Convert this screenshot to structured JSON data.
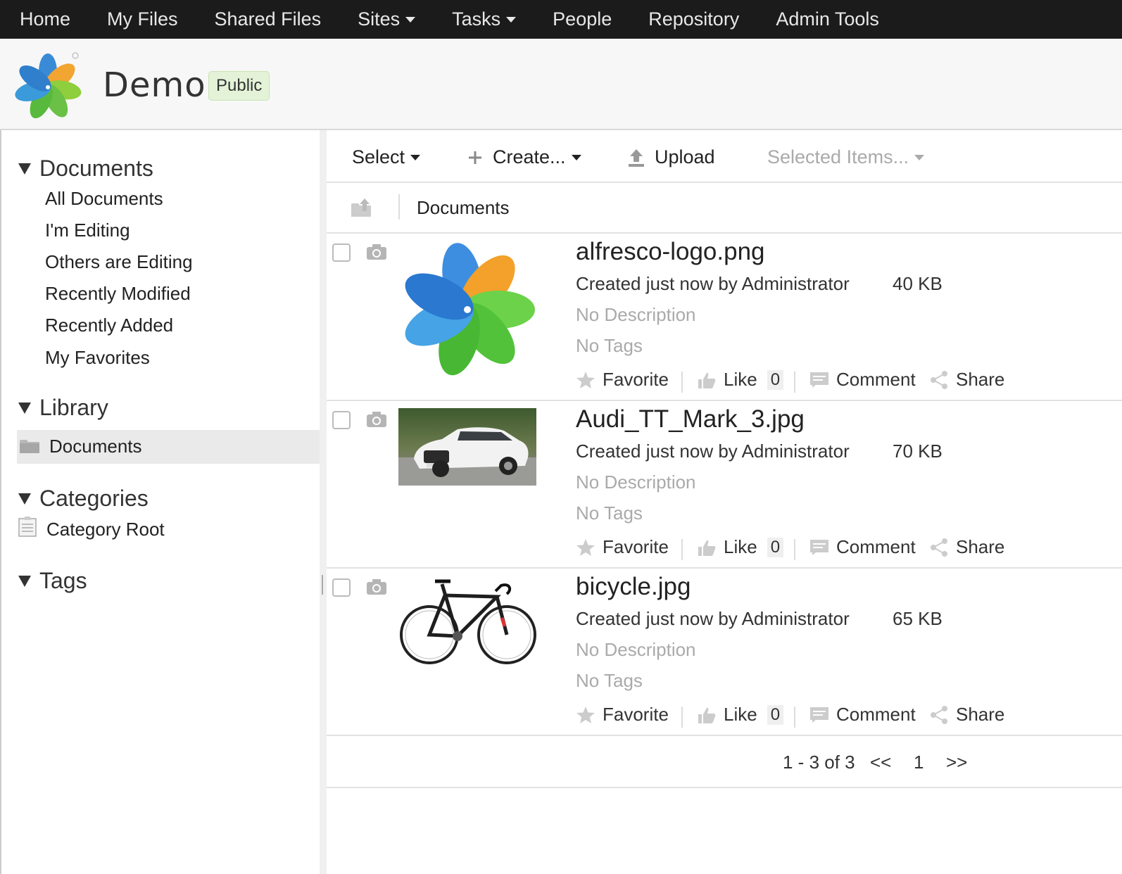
{
  "topnav": {
    "items": [
      {
        "label": "Home",
        "dropdown": false
      },
      {
        "label": "My Files",
        "dropdown": false
      },
      {
        "label": "Shared Files",
        "dropdown": false
      },
      {
        "label": "Sites",
        "dropdown": true
      },
      {
        "label": "Tasks",
        "dropdown": true
      },
      {
        "label": "People",
        "dropdown": false
      },
      {
        "label": "Repository",
        "dropdown": false
      },
      {
        "label": "Admin Tools",
        "dropdown": false
      }
    ]
  },
  "site": {
    "title": "Demo",
    "visibility": "Public"
  },
  "sidebar": {
    "documents": {
      "heading": "Documents",
      "items": [
        "All Documents",
        "I'm Editing",
        "Others are Editing",
        "Recently Modified",
        "Recently Added",
        "My Favorites"
      ]
    },
    "library": {
      "heading": "Library",
      "folder": "Documents"
    },
    "categories": {
      "heading": "Categories",
      "root": "Category Root"
    },
    "tags": {
      "heading": "Tags"
    }
  },
  "toolbar": {
    "select_label": "Select",
    "create_label": "Create...",
    "upload_label": "Upload",
    "selected_items_label": "Selected Items..."
  },
  "breadcrumb": {
    "current": "Documents"
  },
  "files": [
    {
      "name": "alfresco-logo.png",
      "meta": "Created just now by Administrator",
      "size": "40 KB",
      "description": "No Description",
      "tags": "No Tags",
      "thumbnail": "alfresco-logo",
      "likes": "0"
    },
    {
      "name": "Audi_TT_Mark_3.jpg",
      "meta": "Created just now by Administrator",
      "size": "70 KB",
      "description": "No Description",
      "tags": "No Tags",
      "thumbnail": "white-car-photo",
      "likes": "0"
    },
    {
      "name": "bicycle.jpg",
      "meta": "Created just now by Administrator",
      "size": "65 KB",
      "description": "No Description",
      "tags": "No Tags",
      "thumbnail": "road-bicycle-photo",
      "likes": "0"
    }
  ],
  "actions": {
    "favorite": "Favorite",
    "like": "Like",
    "comment": "Comment",
    "share": "Share"
  },
  "pagination": {
    "range": "1 - 3 of 3",
    "prev": "<<",
    "page": "1",
    "next": ">>"
  },
  "colors": {
    "topbar_bg": "#1b1b1b",
    "badge_bg": "#e4f3d8",
    "muted_text": "#aaaaaa"
  }
}
